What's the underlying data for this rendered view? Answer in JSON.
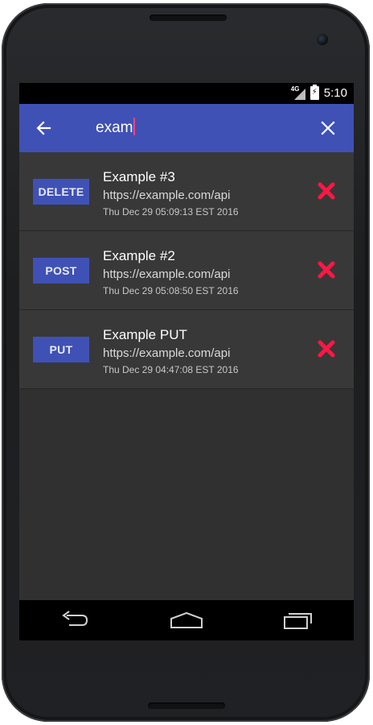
{
  "status_bar": {
    "network": "4G",
    "time": "5:10"
  },
  "toolbar": {
    "back_icon": "arrow-back-icon",
    "search_query": "exam",
    "clear_icon": "close-icon",
    "background_color": "#3f51b5"
  },
  "requests": [
    {
      "method": "DELETE",
      "title": "Example #3",
      "url": "https://example.com/api",
      "date": "Thu Dec 29 05:09:13 EST 2016"
    },
    {
      "method": "POST",
      "title": "Example #2",
      "url": "https://example.com/api",
      "date": "Thu Dec 29 05:08:50 EST 2016"
    },
    {
      "method": "PUT",
      "title": "Example PUT",
      "url": "https://example.com/api",
      "date": "Thu Dec 29 04:47:08 EST 2016"
    }
  ],
  "colors": {
    "accent": "#ff1744",
    "badge": "#3f51b5",
    "list_background": "#383838",
    "screen_background": "#303030"
  },
  "nav_bar": {
    "back_icon": "nav-back-icon",
    "home_icon": "nav-home-icon",
    "recents_icon": "nav-recents-icon"
  }
}
